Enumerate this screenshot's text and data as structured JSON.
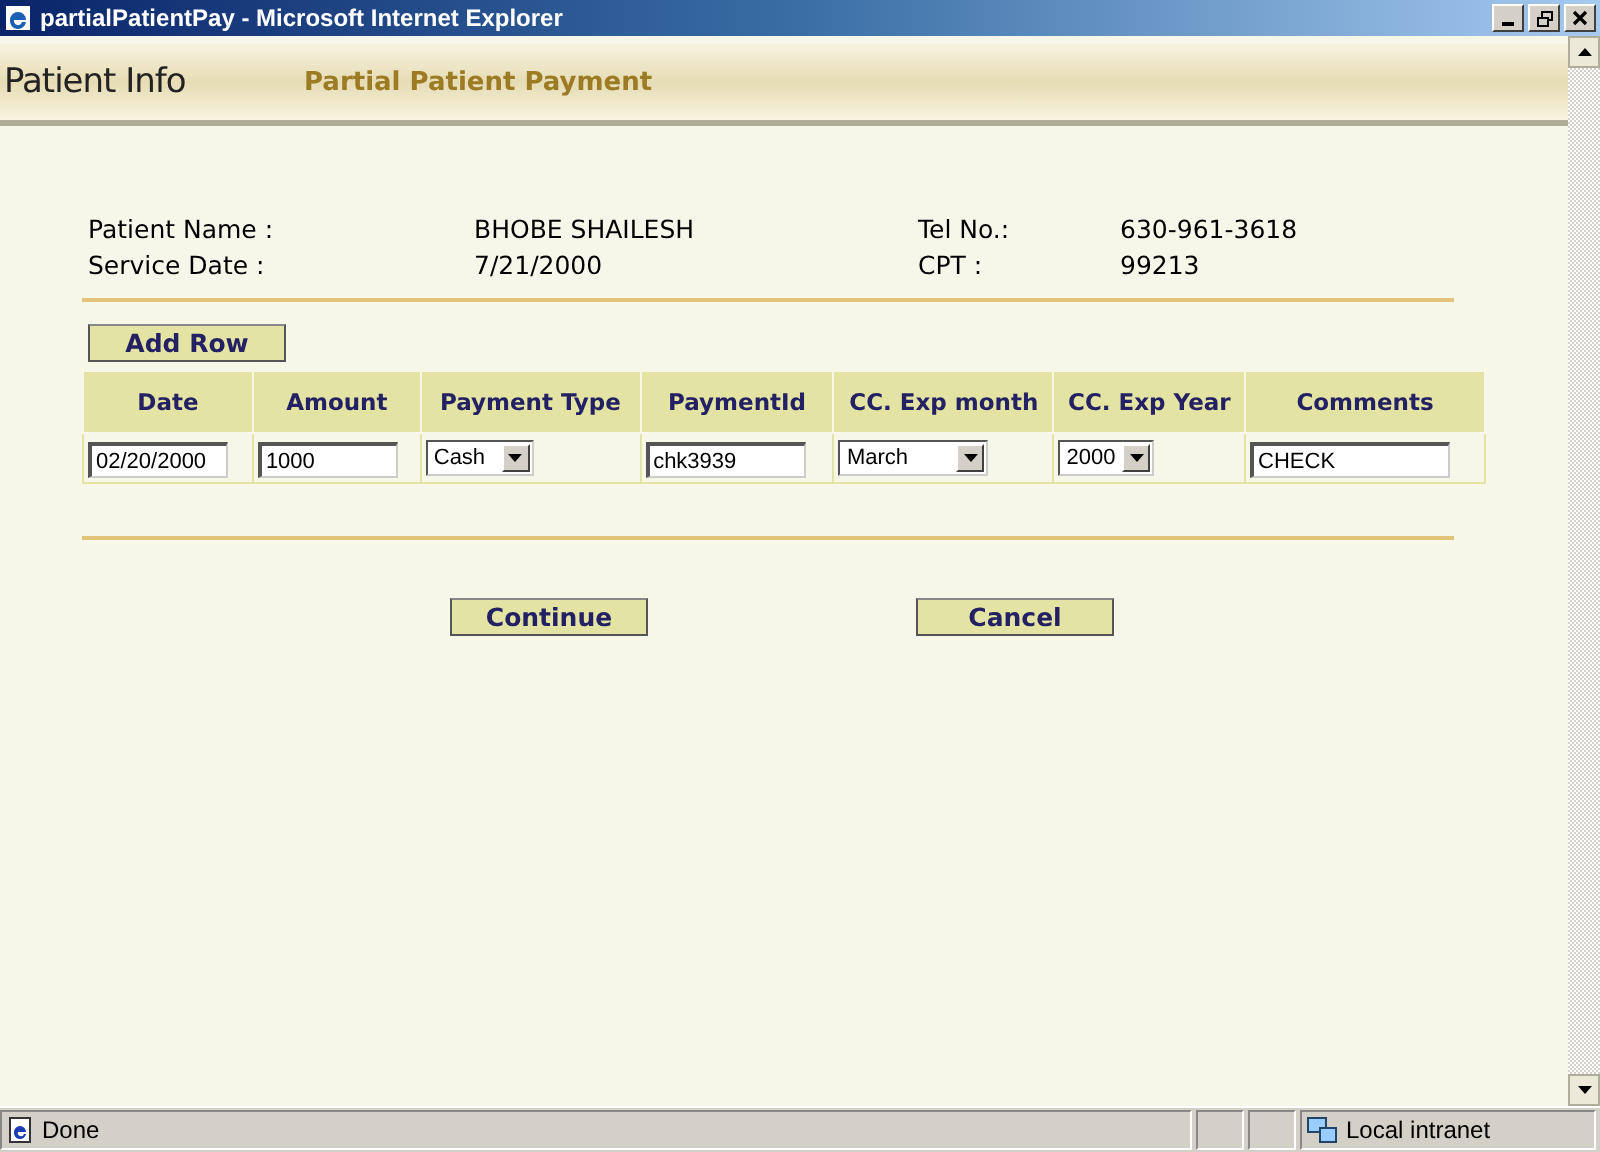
{
  "window": {
    "title": "partialPatientPay - Microsoft Internet Explorer"
  },
  "header": {
    "logo": "Patient Info",
    "title": "Partial Patient Payment"
  },
  "info": [
    {
      "label": "Patient Name :",
      "value": "BHOBE SHAILESH",
      "label2": "Tel No.:",
      "value2": "630-961-3618"
    },
    {
      "label": "Service Date :",
      "value": "7/21/2000",
      "label2": "CPT :",
      "value2": "99213"
    }
  ],
  "add_row_button": "Add Row",
  "table": {
    "columns": [
      "Date",
      "Amount",
      "Payment Type",
      "PaymentId",
      "CC. Exp month",
      "CC. Exp Year",
      "Comments"
    ],
    "rows": [
      [
        {
          "kind": "input",
          "value": "02/20/2000"
        },
        {
          "kind": "input",
          "value": "1000"
        },
        {
          "kind": "select",
          "value": "Cash"
        },
        {
          "kind": "input",
          "value": "chk3939"
        },
        {
          "kind": "select",
          "value": "March"
        },
        {
          "kind": "select",
          "value": "2000"
        },
        {
          "kind": "input",
          "value": "CHECK"
        }
      ]
    ]
  },
  "buttons": [
    "Continue",
    "Cancel"
  ],
  "status_bar": {
    "text": "Done",
    "zone": "Local intranet"
  }
}
